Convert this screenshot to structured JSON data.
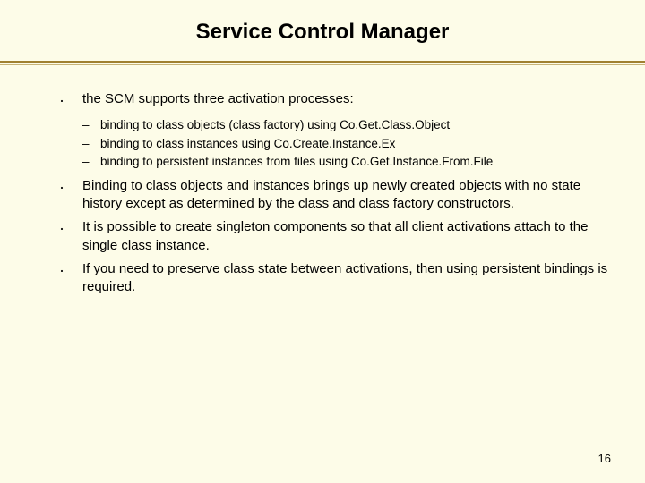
{
  "title": "Service Control Manager",
  "bullets": {
    "b1": "the SCM supports three activation processes:",
    "b1_sub1": "binding to class objects (class factory) using Co.Get.Class.Object",
    "b1_sub2": "binding to class instances using Co.Create.Instance.Ex",
    "b1_sub3": "binding to persistent instances from files using Co.Get.Instance.From.File",
    "b2": "Binding to class objects and instances brings up newly created objects with no state history except as determined by the class and class factory constructors.",
    "b3": "It is possible to create singleton components so that all client activations attach to the single class instance.",
    "b4": "If you need to preserve class state between activations, then using persistent bindings is required."
  },
  "page_number": "16"
}
